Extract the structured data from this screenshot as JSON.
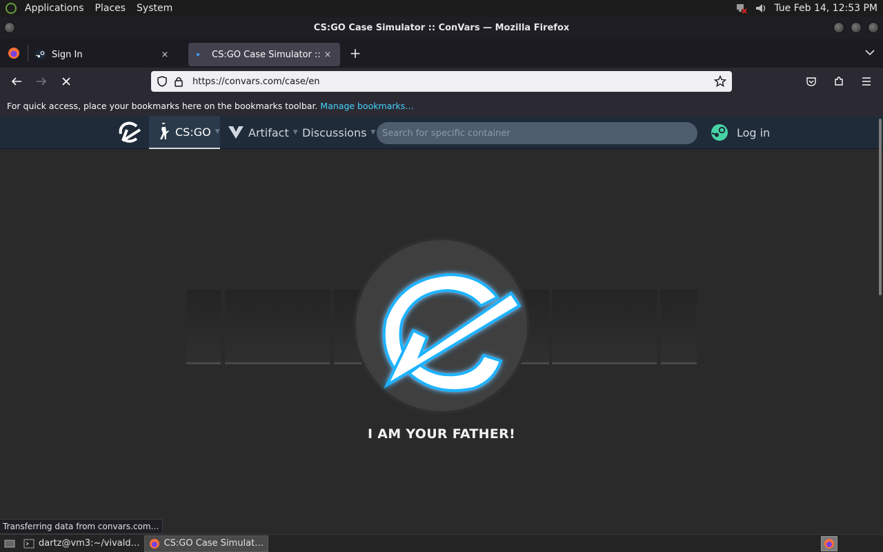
{
  "panel": {
    "menus": [
      "Applications",
      "Places",
      "System"
    ],
    "datetime": "Tue Feb 14, 12:53 PM"
  },
  "window": {
    "title": "CS:GO Case Simulator :: ConVars — Mozilla Firefox"
  },
  "tabs": [
    {
      "label": "Sign In",
      "close": "×"
    },
    {
      "label": "CS:GO Case Simulator :: ConVars",
      "close": "×"
    }
  ],
  "nav": {
    "url": "https://convars.com/case/en"
  },
  "bookmarks": {
    "message": "For quick access, place your bookmarks here on the bookmarks toolbar.",
    "link": "Manage bookmarks…"
  },
  "site": {
    "tabs": [
      "CS:GO",
      "Artifact",
      "Discussions"
    ],
    "search_placeholder": "Search for specific container",
    "login": "Log in",
    "loading_text": "I AM YOUR FATHER!"
  },
  "status": "Transferring data from convars.com…",
  "taskbar": {
    "items": [
      "dartz@vm3:~/vivald…",
      "CS:GO Case Simulat…"
    ]
  },
  "colors": {
    "glow": "#1fb3ff",
    "site_nav_bg": "#1f2b38",
    "steam_green": "#46d3a6"
  }
}
